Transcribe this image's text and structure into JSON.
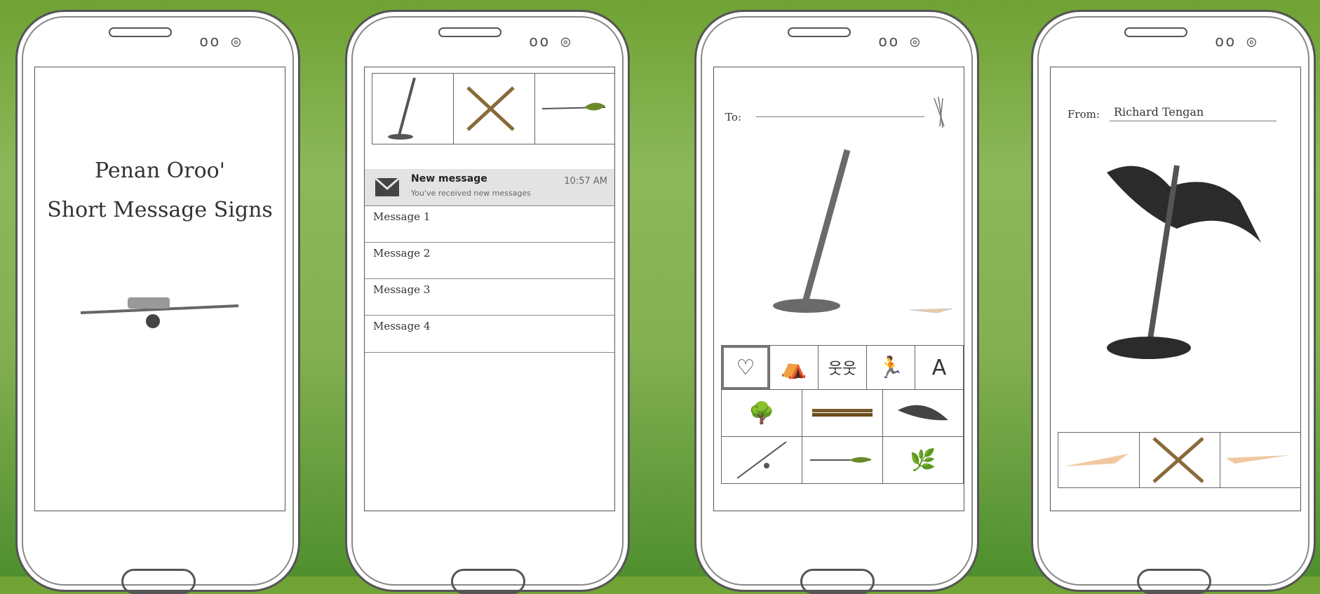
{
  "phone1": {
    "title_line1": "Penan Oroo'",
    "title_line2": "Short Message Signs"
  },
  "phone2": {
    "signs": [
      "stick-sign",
      "crossed-sticks-sign",
      "leaf-arrow-sign"
    ],
    "notification": {
      "title": "New message",
      "subtitle": "You've received new messages",
      "time": "10:57 AM"
    },
    "messages": [
      "Message 1",
      "Message 2",
      "Message 3",
      "Message 4"
    ]
  },
  "phone3": {
    "to_label": "To:",
    "palette_row1": [
      "heart-sign",
      "camp-sign",
      "people-sign",
      "runner-sign",
      "A"
    ],
    "palette_row2": [
      "tree-sign",
      "bundle-sign",
      "leaf-sign"
    ],
    "palette_row3": [
      "pole-sign",
      "leaf-arrow-sign",
      "leaf-cluster-sign"
    ]
  },
  "phone4": {
    "from_label": "From:",
    "from_value": "Richard Tengan",
    "signs": [
      "feather-sign",
      "crossed-sticks-sign",
      "feather-sign"
    ]
  },
  "colors": {
    "background_top": "#6fa233",
    "background_bottom": "#4f8f2e",
    "frame": "#555555"
  }
}
